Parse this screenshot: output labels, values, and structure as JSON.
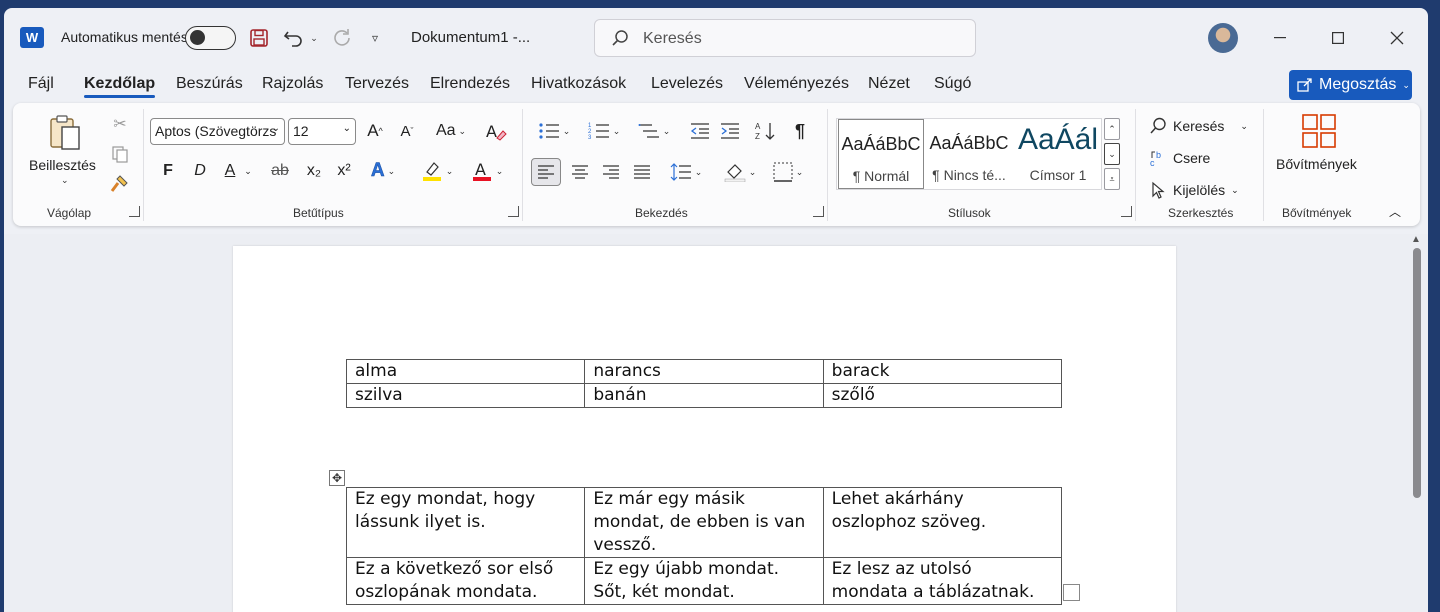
{
  "titlebar": {
    "autosave_label": "Automatikus mentés",
    "doc_title": "Dokumentum1  -...",
    "search_placeholder": "Keresés"
  },
  "tabs": [
    {
      "label": "Fájl"
    },
    {
      "label": "Kezdőlap",
      "active": true
    },
    {
      "label": "Beszúrás"
    },
    {
      "label": "Rajzolás"
    },
    {
      "label": "Tervezés"
    },
    {
      "label": "Elrendezés"
    },
    {
      "label": "Hivatkozások"
    },
    {
      "label": "Levelezés"
    },
    {
      "label": "Véleményezés"
    },
    {
      "label": "Nézet"
    },
    {
      "label": "Súgó"
    }
  ],
  "share_label": "Megosztás",
  "ribbon": {
    "clipboard": {
      "paste_label": "Beillesztés",
      "group_label": "Vágólap"
    },
    "font": {
      "font_name": "Aptos (Szövegtörzs",
      "font_size": "12",
      "bold": "F",
      "italic": "D",
      "underline": "A",
      "strike": "ab",
      "subscript": "x₂",
      "superscript": "x²",
      "change_case": "Aa",
      "group_label": "Betűtípus"
    },
    "paragraph": {
      "group_label": "Bekezdés"
    },
    "styles": {
      "items": [
        {
          "preview": "AaÁáBbC",
          "name": "¶ Normál"
        },
        {
          "preview": "AaÁáBbC",
          "name": "¶ Nincs té..."
        },
        {
          "preview": "AaÁál",
          "name": "Címsor 1"
        }
      ],
      "group_label": "Stílusok"
    },
    "editing": {
      "find": "Keresés",
      "replace": "Csere",
      "select": "Kijelölés",
      "group_label": "Szerkesztés"
    },
    "addins": {
      "button_label": "Bővítmények",
      "group_label": "Bővítmények"
    }
  },
  "document": {
    "table1": [
      [
        "alma",
        "narancs",
        "barack"
      ],
      [
        "szilva",
        "banán",
        "szőlő"
      ]
    ],
    "table2": [
      [
        "Ez egy mondat, hogy lássunk ilyet is.",
        "Ez már egy másik mondat, de ebben is van vessző.",
        "Lehet akárhány oszlophoz szöveg."
      ],
      [
        "Ez a következő sor első oszlopának mondata.",
        "Ez egy újabb mondat. Sőt, két mondat.",
        "Ez lesz az utolsó mondata a táblázatnak."
      ]
    ]
  },
  "colors": {
    "accent": "#185abd",
    "highlight": "#ffe100",
    "font_color": "#e81123",
    "addins_icon": "#d83b01"
  }
}
